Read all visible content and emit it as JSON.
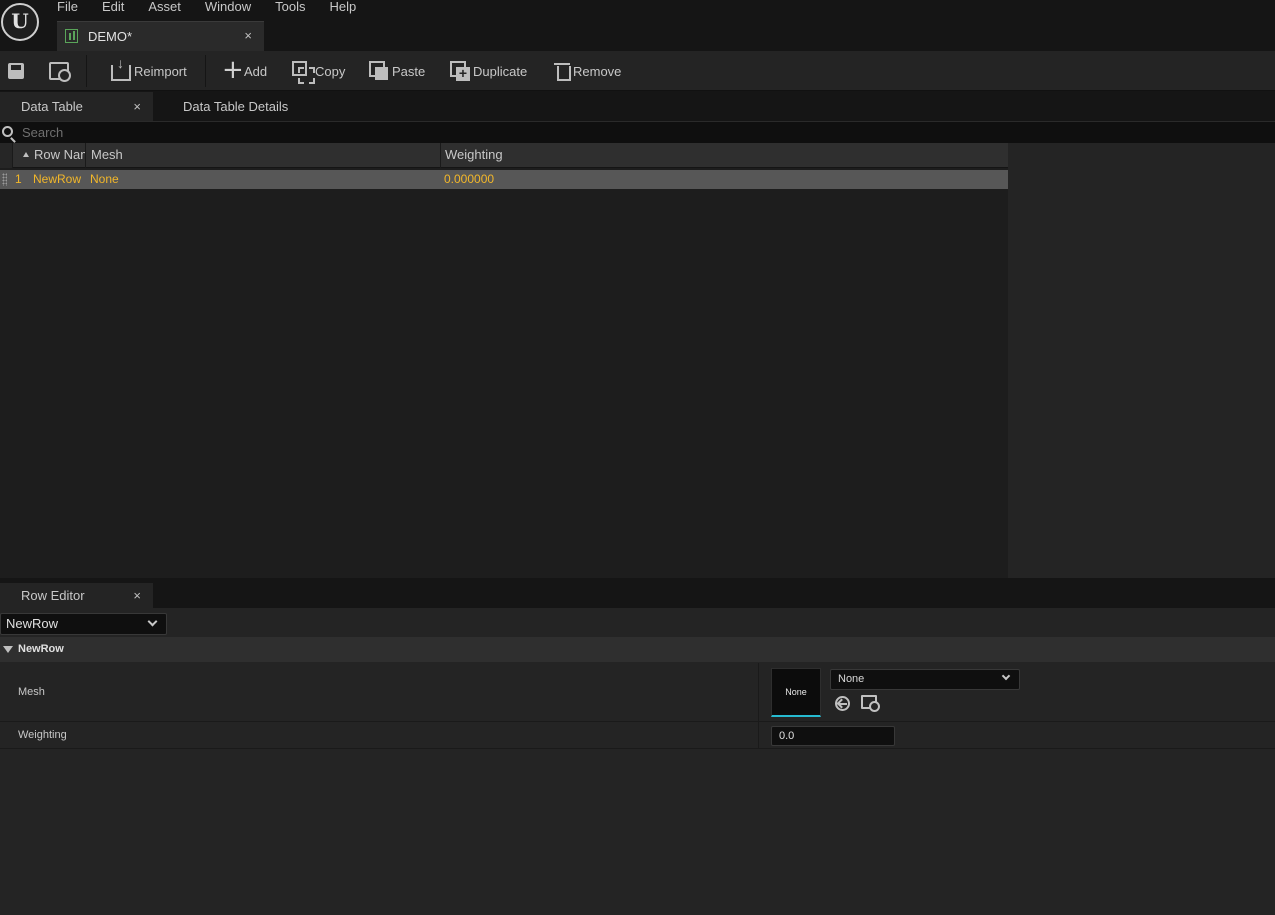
{
  "menu": {
    "items": [
      "File",
      "Edit",
      "Asset",
      "Window",
      "Tools",
      "Help"
    ]
  },
  "document_tab": {
    "title": "DEMO*",
    "close": "×"
  },
  "toolbar": {
    "reimport": "Reimport",
    "add": "Add",
    "copy": "Copy",
    "paste": "Paste",
    "duplicate": "Duplicate",
    "remove": "Remove"
  },
  "panels": {
    "data_table": "Data Table",
    "data_table_details": "Data Table Details",
    "close": "×"
  },
  "search": {
    "placeholder": "Search"
  },
  "table": {
    "columns": [
      "Row Name",
      "Mesh",
      "Weighting"
    ],
    "rows": [
      {
        "index": "1",
        "row_name": "NewRow",
        "mesh": "None",
        "weighting": "0.000000"
      }
    ]
  },
  "row_editor": {
    "tab": "Row Editor",
    "close": "×",
    "selected_row": "NewRow",
    "category": "NewRow",
    "properties": {
      "mesh_label": "Mesh",
      "mesh_thumbnail": "None",
      "mesh_value": "None",
      "weighting_label": "Weighting",
      "weighting_value": "0.0"
    }
  },
  "colors": {
    "accent_cyan": "#26bbd1",
    "row_text": "#f2b72a",
    "selected_row": "#575757",
    "datatable_icon": "#5aa55a"
  },
  "icons": [
    "unreal-logo-icon",
    "datatable-icon",
    "save-icon",
    "browse-icon",
    "reimport-icon",
    "plus-icon",
    "copy-icon",
    "paste-icon",
    "duplicate-icon",
    "trash-icon",
    "search-icon",
    "chevron-down-icon",
    "use-selected-icon"
  ]
}
